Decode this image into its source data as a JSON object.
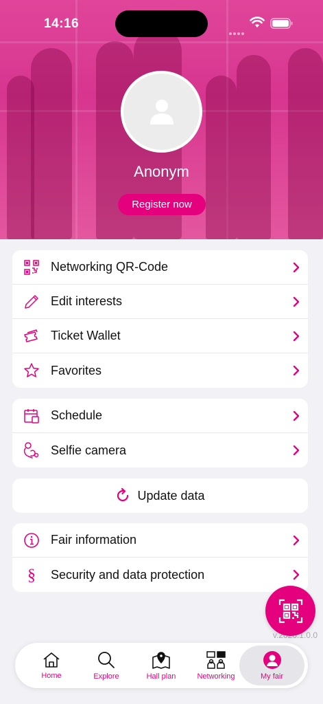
{
  "status_bar": {
    "time": "14:16"
  },
  "profile": {
    "name": "Anonym",
    "register_label": "Register now"
  },
  "menu_group_1": [
    {
      "label": "Networking QR-Code",
      "icon": "qr-code-icon"
    },
    {
      "label": "Edit interests",
      "icon": "pencil-icon"
    },
    {
      "label": "Ticket Wallet",
      "icon": "ticket-icon"
    },
    {
      "label": "Favorites",
      "icon": "star-icon"
    }
  ],
  "menu_group_2": [
    {
      "label": "Schedule",
      "icon": "calendar-icon"
    },
    {
      "label": "Selfie camera",
      "icon": "selfie-icon"
    }
  ],
  "update": {
    "label": "Update data",
    "icon": "refresh-icon"
  },
  "menu_group_3": [
    {
      "label": "Fair information",
      "icon": "info-icon"
    },
    {
      "label": "Security and data protection",
      "icon": "section-icon"
    }
  ],
  "version": "v.2026.1.0.0",
  "tabs": [
    {
      "label": "Home",
      "icon": "home-icon"
    },
    {
      "label": "Explore",
      "icon": "search-icon"
    },
    {
      "label": "Hall plan",
      "icon": "map-icon"
    },
    {
      "label": "Networking",
      "icon": "networking-icon"
    },
    {
      "label": "My fair",
      "icon": "profile-icon",
      "active": true
    }
  ],
  "colors": {
    "accent": "#e5007d",
    "background": "#f2f2f6"
  }
}
